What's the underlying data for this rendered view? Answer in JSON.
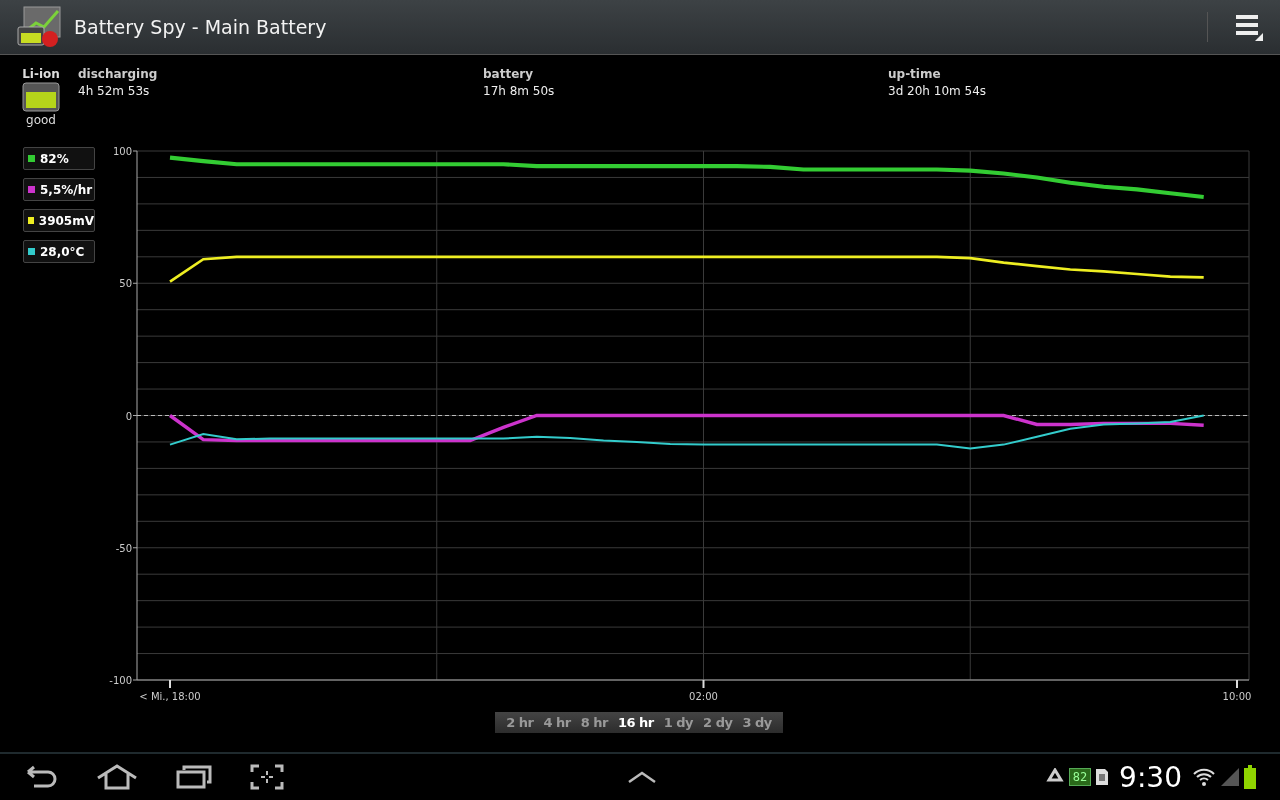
{
  "app_bar": {
    "title": "Battery Spy - Main Battery"
  },
  "info": {
    "battery_type": "Li-ion",
    "health": "good",
    "fields": [
      {
        "label": "discharging",
        "value": "4h 52m 53s"
      },
      {
        "label": "battery",
        "value": "17h 8m 50s"
      },
      {
        "label": "up-time",
        "value": "3d 20h 10m 54s"
      }
    ]
  },
  "chart_data": {
    "type": "line",
    "grid": true,
    "ref_lines": [
      {
        "axis": "y",
        "value": 0
      }
    ],
    "categories": [
      "< Mi., 18:00",
      null,
      null,
      null,
      null,
      null,
      null,
      null,
      null,
      null,
      null,
      null,
      null,
      null,
      null,
      null,
      "02:00",
      null,
      null,
      null,
      null,
      null,
      null,
      null,
      null,
      null,
      null,
      null,
      null,
      null,
      null,
      null,
      "10:00"
    ],
    "ylim": [
      -100,
      100
    ],
    "yticks": [
      100,
      50,
      0,
      -50,
      -100
    ],
    "series": [
      {
        "name": "82%",
        "color": "#33cc33",
        "values": [
          97.5,
          96.2,
          95,
          95,
          95,
          95,
          95,
          95,
          95,
          95,
          95,
          94.3,
          94.3,
          94.3,
          94.3,
          94.3,
          94.3,
          94.3,
          94,
          93,
          93,
          93,
          93,
          93,
          92.6,
          91.5,
          90,
          88,
          86.5,
          85.5,
          84,
          82.6,
          null
        ]
      },
      {
        "name": "5,5%/hr",
        "color": "#cc33cc",
        "values": [
          0,
          -9.1,
          -9.5,
          -9.5,
          -9.5,
          -9.5,
          -9.5,
          -9.5,
          -9.5,
          -9.5,
          -4.5,
          0,
          0,
          0,
          0,
          0,
          0,
          0,
          0,
          0,
          0,
          0,
          0,
          0,
          0,
          0,
          -3.4,
          -3.4,
          -3,
          -3,
          -3,
          -3.7,
          null
        ]
      },
      {
        "name": "3905mV",
        "color": "#eeee22",
        "values": [
          50.6,
          59.1,
          60,
          60,
          60,
          60,
          60,
          60,
          60,
          60,
          60,
          60,
          60,
          60,
          60,
          60,
          60,
          60,
          60,
          60,
          60,
          60,
          60,
          60,
          59.5,
          57.8,
          56.5,
          55.2,
          54.5,
          53.5,
          52.5,
          52.2,
          null
        ]
      },
      {
        "name": "28,0°C",
        "color": "#33cccc",
        "values": [
          -11,
          -7,
          -9,
          -8.7,
          -8.7,
          -8.7,
          -8.7,
          -8.7,
          -8.7,
          -8.7,
          -8.7,
          -8,
          -8.5,
          -9.5,
          -10,
          -10.8,
          -11,
          -11,
          -11,
          -11,
          -11,
          -11,
          -11,
          -11,
          -12.5,
          -11,
          -8,
          -5,
          -3.4,
          -3,
          -2.5,
          0,
          null
        ]
      }
    ]
  },
  "ranges": [
    {
      "label": "2 hr",
      "selected": false
    },
    {
      "label": "4 hr",
      "selected": false
    },
    {
      "label": "8 hr",
      "selected": false
    },
    {
      "label": "16 hr",
      "selected": true
    },
    {
      "label": "1 dy",
      "selected": false
    },
    {
      "label": "2 dy",
      "selected": false
    },
    {
      "label": "3 dy",
      "selected": false
    }
  ],
  "status_bar": {
    "monitor_reading": "82",
    "time": "9:30"
  }
}
